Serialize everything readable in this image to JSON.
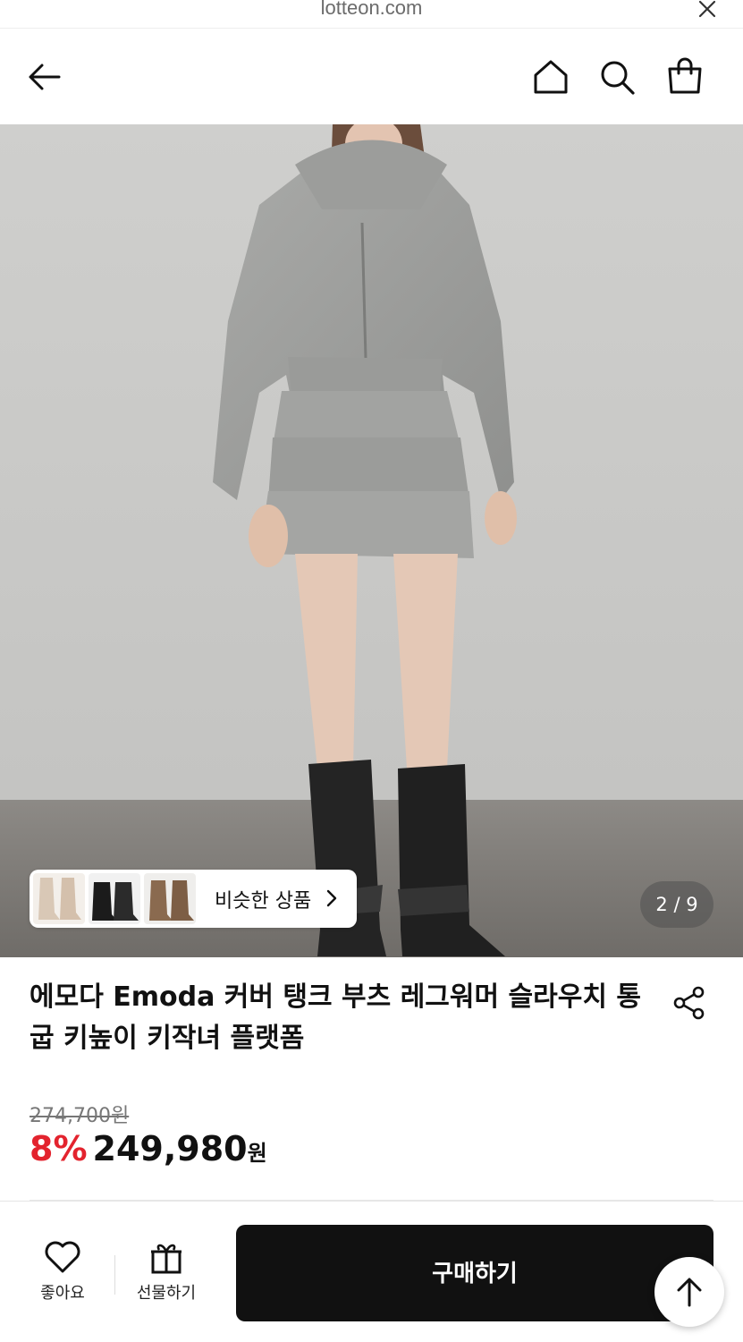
{
  "browser": {
    "url": "lotteon.com"
  },
  "header": {
    "icons": [
      "back-arrow-icon",
      "home-icon",
      "search-icon",
      "shopping-bag-icon"
    ]
  },
  "gallery": {
    "similar_label": "비슷한 상품",
    "counter": "2 / 9"
  },
  "product": {
    "title": "에모다 Emoda 커버 탱크 부츠 레그워머 슬라우치 통굽 키높이 키작녀 플랫폼",
    "original_price": "274,700원",
    "discount": "8%",
    "price": "249,980",
    "currency": "원"
  },
  "bottom": {
    "like_label": "좋아요",
    "gift_label": "선물하기",
    "buy_label": "구매하기"
  },
  "colors": {
    "discount": "#e3232e",
    "buy_button": "#111111"
  }
}
